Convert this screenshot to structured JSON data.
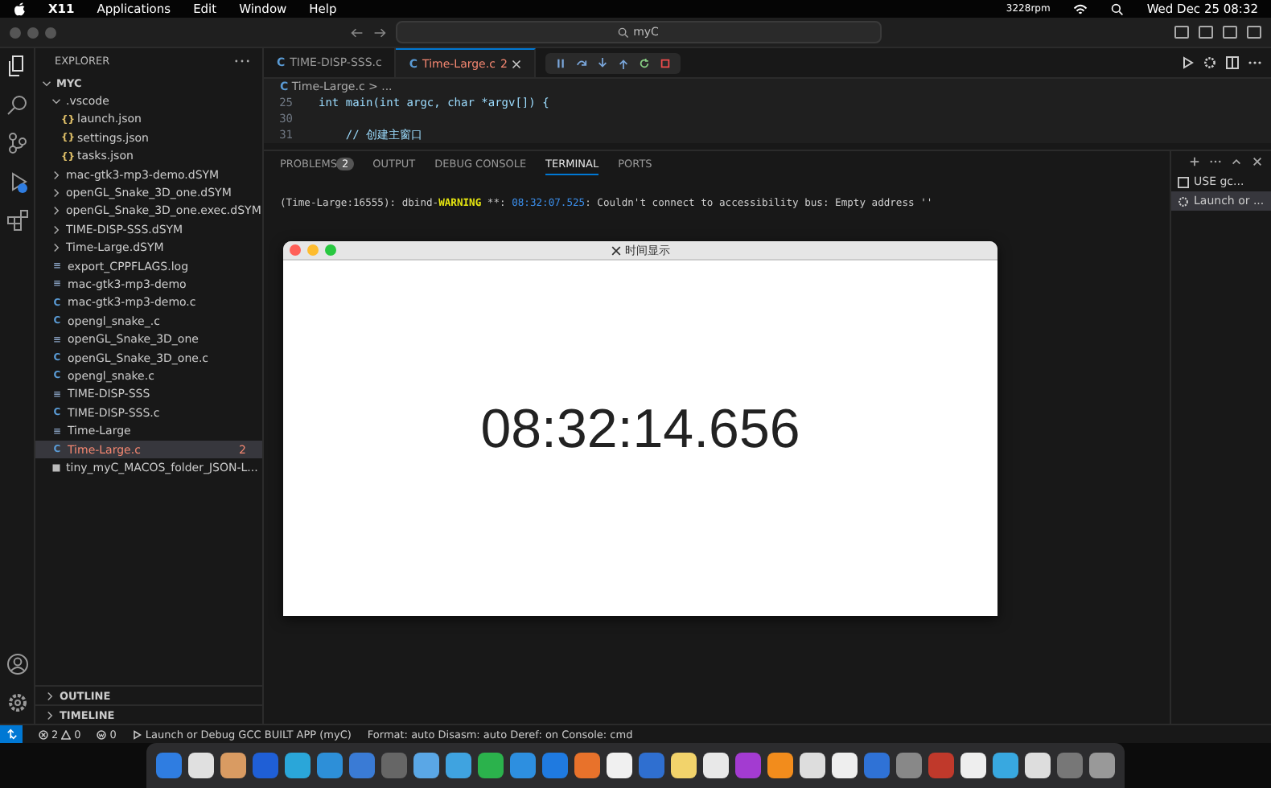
{
  "menubar": {
    "items": [
      "X11",
      "Applications",
      "Edit",
      "Window",
      "Help"
    ],
    "fan": "3228rpm",
    "clock": "Wed Dec 25  08:32"
  },
  "titlebar": {
    "search": "myC"
  },
  "sidebar": {
    "title": "EXPLORER",
    "root": {
      "name": "MYC",
      "expanded": true,
      "children": [
        {
          "name": ".vscode",
          "kind": "folder",
          "expanded": true,
          "selected": false,
          "children": [
            {
              "name": "launch.json",
              "kind": "json",
              "icon": "{}",
              "selected": false
            },
            {
              "name": "settings.json",
              "kind": "json",
              "icon": "{}",
              "selected": false
            },
            {
              "name": "tasks.json",
              "kind": "json",
              "icon": "{}",
              "selected": false
            }
          ]
        },
        {
          "name": "mac-gtk3-mp3-demo.dSYM",
          "kind": "folder",
          "expanded": false,
          "selected": false
        },
        {
          "name": "openGL_Snake_3D_one.dSYM",
          "kind": "folder",
          "expanded": false,
          "selected": false
        },
        {
          "name": "openGL_Snake_3D_one.exec.dSYM",
          "kind": "folder",
          "expanded": false,
          "selected": false
        },
        {
          "name": "TIME-DISP-SSS.dSYM",
          "kind": "folder",
          "expanded": false,
          "selected": false
        },
        {
          "name": "Time-Large.dSYM",
          "kind": "folder",
          "expanded": false,
          "selected": false
        },
        {
          "name": "export_CPPFLAGS.log",
          "kind": "text",
          "icon": "≡",
          "selected": false
        },
        {
          "name": "mac-gtk3-mp3-demo",
          "kind": "text",
          "icon": "≡",
          "selected": false
        },
        {
          "name": "mac-gtk3-mp3-demo.c",
          "kind": "c",
          "icon": "C",
          "selected": false
        },
        {
          "name": "opengl_snake_.c",
          "kind": "c",
          "icon": "C",
          "selected": false
        },
        {
          "name": "openGL_Snake_3D_one",
          "kind": "text",
          "icon": "≡",
          "selected": false
        },
        {
          "name": "openGL_Snake_3D_one.c",
          "kind": "c",
          "icon": "C",
          "selected": false
        },
        {
          "name": "opengl_snake.c",
          "kind": "c",
          "icon": "C",
          "selected": false
        },
        {
          "name": "TIME-DISP-SSS",
          "kind": "text",
          "icon": "≡",
          "selected": false
        },
        {
          "name": "TIME-DISP-SSS.c",
          "kind": "c",
          "icon": "C",
          "selected": false
        },
        {
          "name": "Time-Large",
          "kind": "text",
          "icon": "≡",
          "selected": false
        },
        {
          "name": "Time-Large.c",
          "kind": "c",
          "icon": "C",
          "selected": true,
          "badge": "2"
        },
        {
          "name": "tiny_myC_MACOS_folder_JSON-L...",
          "kind": "archive",
          "selected": false
        }
      ]
    },
    "sections": [
      "OUTLINE",
      "TIMELINE"
    ]
  },
  "tabs": [
    {
      "icon": "C",
      "label": "TIME-DISP-SSS.c",
      "selected": false
    },
    {
      "icon": "C",
      "label": "Time-Large.c",
      "selected": true,
      "badge": "2"
    }
  ],
  "breadcrumb": {
    "icon": "C",
    "items": [
      "Time-Large.c",
      ">",
      "..."
    ]
  },
  "code": [
    {
      "line": "25",
      "text": "int main(int argc, char *argv[]) {"
    },
    {
      "line": "30"
    },
    {
      "line": "31",
      "text": "    // 创建主窗口"
    }
  ],
  "panel": {
    "tabs": [
      {
        "label": "PROBLEMS",
        "selected": false,
        "badge": "2"
      },
      {
        "label": "OUTPUT",
        "selected": false
      },
      {
        "label": "DEBUG CONSOLE",
        "selected": false
      },
      {
        "label": "TERMINAL",
        "selected": true
      },
      {
        "label": "PORTS",
        "selected": false
      }
    ],
    "terminal": {
      "prefix": "(Time-Large:16555): dbind-",
      "level": "WARNING",
      "sep": " **: ",
      "time": "08:32:07.525",
      "message": ": Couldn't connect to accessibility bus: Empty address ''"
    },
    "terminals": [
      {
        "label": "USE gc...",
        "kind": "task",
        "selected": false
      },
      {
        "label": "Launch or ...",
        "kind": "debug",
        "selected": true
      }
    ]
  },
  "app_window": {
    "title": "时间显示",
    "clock": "08:32:14.656"
  },
  "statusbar": {
    "errors": "2",
    "warnings": "0",
    "ports": "0",
    "launch": "Launch or Debug GCC BUILT APP (myC)",
    "debug_info": "Format: auto  Disasm: auto  Deref: on  Console: cmd"
  }
}
